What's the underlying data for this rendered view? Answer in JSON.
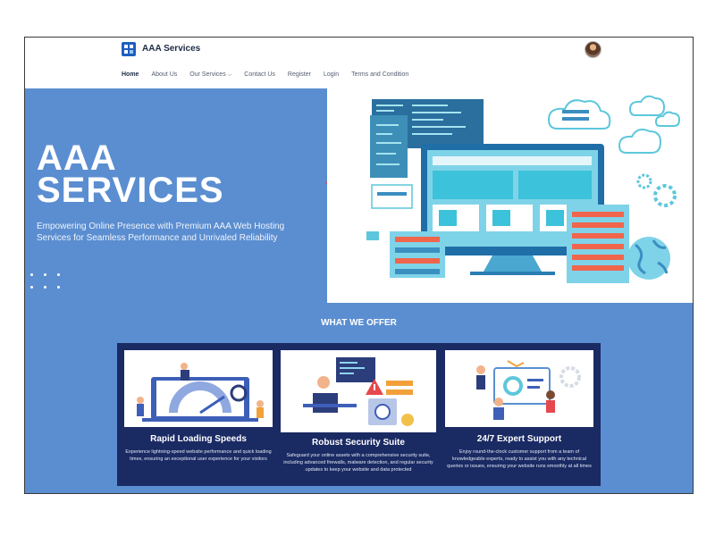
{
  "brand": {
    "name": "AAA Services"
  },
  "nav": {
    "items": [
      {
        "label": "Home"
      },
      {
        "label": "About Us"
      },
      {
        "label": "Our Services"
      },
      {
        "label": "Contact Us"
      },
      {
        "label": "Register"
      },
      {
        "label": "Login"
      },
      {
        "label": "Terms and Condition"
      }
    ]
  },
  "hero": {
    "title_line1": "AAA",
    "title_line2": "SERVICES",
    "subtitle": "Empowering Online Presence with Premium AAA Web Hosting Services for Seamless Performance and Unrivaled Reliability"
  },
  "offer": {
    "title": "WHAT WE OFFER",
    "cards": [
      {
        "title": "Rapid Loading Speeds",
        "desc": "Experience lightning-speed website performance and quick loading times, ensuring an exceptional user experience for your visitors",
        "icon": "speed-illustration"
      },
      {
        "title": "Robust Security Suite",
        "desc": "Safeguard your online assets with a comprehensive security suite, including advanced firewalls, malware detection, and regular security updates to keep your website and data protected",
        "icon": "security-illustration"
      },
      {
        "title": "24/7 Expert Support",
        "desc": "Enjoy round-the-clock customer support from a team of knowledgeable experts, ready to assist you with any technical queries or issues, ensuring your website runs smoothly at all times",
        "icon": "support-illustration"
      }
    ]
  },
  "colors": {
    "hero_blue": "#5b8ed1",
    "card_navy": "#1a2a63",
    "brand_blue": "#1f5fbf"
  }
}
